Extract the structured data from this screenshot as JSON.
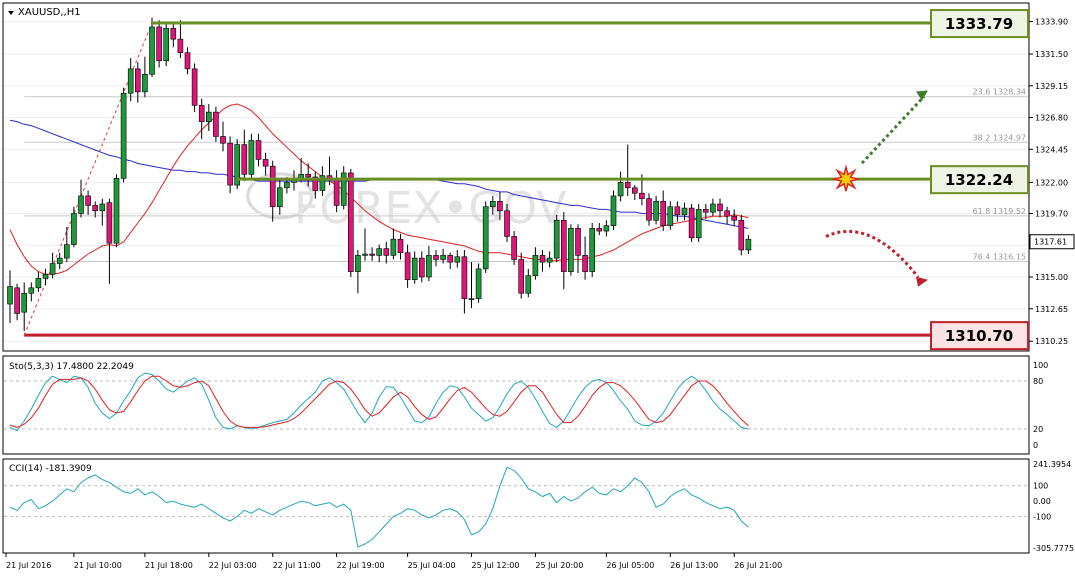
{
  "chart_data": {
    "type": "candlestick",
    "title": "XAUUSD,,H1",
    "price_axis": {
      "range": [
        1309.6,
        1335.2
      ],
      "ticks": [
        "1333.90",
        "1331.50",
        "1329.15",
        "1326.80",
        "1324.45",
        "1322.00",
        "1319.70",
        "1317.35",
        "1315.00",
        "1312.65",
        "1310.25"
      ],
      "tick_values": [
        1333.9,
        1331.5,
        1329.15,
        1326.8,
        1324.45,
        1322.0,
        1319.7,
        1317.35,
        1315.0,
        1312.65,
        1310.25
      ],
      "current_price": "1317.61",
      "current_value": 1317.61
    },
    "time_labels": [
      "21 Jul 2016",
      "21 Jul 10:00",
      "21 Jul 18:00",
      "22 Jul 03:00",
      "22 Jul 11:00",
      "22 Jul 19:00",
      "25 Jul 04:00",
      "25 Jul 12:00",
      "25 Jul 20:00",
      "26 Jul 05:00",
      "26 Jul 13:00",
      "26 Jul 21:00"
    ],
    "candles": [
      [
        1313.0,
        1314.3,
        1311.6,
        1315.5
      ],
      [
        1314.2,
        1312.3,
        1311.8,
        1314.5
      ],
      [
        1312.4,
        1313.8,
        1311.0,
        1314.6
      ],
      [
        1313.8,
        1314.2,
        1313.2,
        1314.6
      ],
      [
        1314.2,
        1314.9,
        1313.9,
        1315.4
      ],
      [
        1314.9,
        1315.2,
        1314.4,
        1315.6
      ],
      [
        1315.2,
        1316.0,
        1314.9,
        1316.8
      ],
      [
        1316.0,
        1316.4,
        1315.6,
        1316.8
      ],
      [
        1316.4,
        1317.4,
        1316.1,
        1318.7
      ],
      [
        1317.4,
        1319.7,
        1317.2,
        1320.2
      ],
      [
        1319.7,
        1321.0,
        1319.4,
        1322.2
      ],
      [
        1321.0,
        1320.3,
        1319.6,
        1321.4
      ],
      [
        1320.3,
        1319.9,
        1319.4,
        1320.6
      ],
      [
        1319.9,
        1320.4,
        1318.8,
        1320.8
      ],
      [
        1320.5,
        1317.5,
        1314.5,
        1320.8
      ],
      [
        1317.5,
        1322.3,
        1317.2,
        1322.6
      ],
      [
        1322.3,
        1328.6,
        1322.0,
        1329.0
      ],
      [
        1328.6,
        1330.4,
        1328.0,
        1331.2
      ],
      [
        1330.4,
        1328.7,
        1327.9,
        1330.9
      ],
      [
        1328.7,
        1330.0,
        1328.3,
        1331.3
      ],
      [
        1330.0,
        1333.5,
        1329.8,
        1334.2
      ],
      [
        1333.5,
        1331.0,
        1330.5,
        1334.0
      ],
      [
        1331.0,
        1333.4,
        1330.6,
        1333.9
      ],
      [
        1333.4,
        1332.6,
        1332.0,
        1333.9
      ],
      [
        1332.6,
        1331.6,
        1331.2,
        1334.0
      ],
      [
        1331.6,
        1330.4,
        1330.0,
        1332.0
      ],
      [
        1330.4,
        1327.7,
        1327.2,
        1330.8
      ],
      [
        1327.7,
        1326.5,
        1325.2,
        1328.2
      ],
      [
        1326.5,
        1327.2,
        1325.8,
        1327.8
      ],
      [
        1327.2,
        1325.4,
        1325.0,
        1327.6
      ],
      [
        1325.4,
        1324.9,
        1324.3,
        1326.5
      ],
      [
        1324.9,
        1321.8,
        1321.2,
        1325.4
      ],
      [
        1321.8,
        1324.8,
        1321.5,
        1325.2
      ],
      [
        1324.8,
        1322.6,
        1322.1,
        1325.9
      ],
      [
        1322.6,
        1325.1,
        1322.3,
        1325.6
      ],
      [
        1325.1,
        1323.7,
        1323.2,
        1325.6
      ],
      [
        1323.7,
        1323.2,
        1322.5,
        1324.2
      ],
      [
        1323.2,
        1320.2,
        1319.1,
        1323.6
      ],
      [
        1320.2,
        1321.6,
        1319.6,
        1322.3
      ],
      [
        1321.6,
        1322.0,
        1321.2,
        1322.4
      ],
      [
        1322.0,
        1322.3,
        1321.4,
        1322.9
      ],
      [
        1322.3,
        1322.6,
        1322.0,
        1323.8
      ],
      [
        1322.6,
        1322.4,
        1321.7,
        1323.4
      ],
      [
        1322.4,
        1321.4,
        1320.8,
        1322.8
      ],
      [
        1321.4,
        1322.5,
        1321.0,
        1323.2
      ],
      [
        1322.5,
        1322.3,
        1321.8,
        1323.9
      ],
      [
        1322.3,
        1320.3,
        1319.8,
        1322.9
      ],
      [
        1320.3,
        1322.7,
        1320.0,
        1323.2
      ],
      [
        1322.7,
        1315.4,
        1315.0,
        1323.0
      ],
      [
        1315.4,
        1316.6,
        1313.8,
        1317.0
      ],
      [
        1316.6,
        1316.7,
        1316.2,
        1318.6
      ],
      [
        1316.7,
        1316.6,
        1316.2,
        1317.2
      ],
      [
        1316.6,
        1317.1,
        1316.1,
        1317.4
      ],
      [
        1317.1,
        1316.6,
        1316.0,
        1317.6
      ],
      [
        1316.6,
        1317.8,
        1316.3,
        1318.6
      ],
      [
        1317.8,
        1316.8,
        1316.3,
        1318.2
      ],
      [
        1316.8,
        1314.8,
        1314.2,
        1317.4
      ],
      [
        1314.8,
        1316.4,
        1314.5,
        1316.9
      ],
      [
        1316.4,
        1315.0,
        1314.6,
        1316.9
      ],
      [
        1315.0,
        1316.6,
        1314.7,
        1317.3
      ],
      [
        1316.6,
        1316.3,
        1315.8,
        1317.0
      ],
      [
        1316.3,
        1316.6,
        1316.0,
        1317.1
      ],
      [
        1316.6,
        1316.1,
        1315.6,
        1316.8
      ],
      [
        1316.1,
        1316.5,
        1315.7,
        1317.0
      ],
      [
        1316.5,
        1313.4,
        1312.3,
        1317.0
      ],
      [
        1313.4,
        1313.4,
        1312.7,
        1316.1
      ],
      [
        1313.4,
        1315.6,
        1313.1,
        1316.0
      ],
      [
        1315.6,
        1320.2,
        1315.3,
        1320.6
      ],
      [
        1320.2,
        1320.6,
        1319.6,
        1321.0
      ],
      [
        1320.6,
        1319.9,
        1319.2,
        1321.3
      ],
      [
        1319.9,
        1318.0,
        1317.6,
        1320.4
      ],
      [
        1318.0,
        1316.3,
        1315.9,
        1318.4
      ],
      [
        1316.3,
        1313.8,
        1313.4,
        1316.8
      ],
      [
        1313.8,
        1315.1,
        1313.5,
        1315.6
      ],
      [
        1315.1,
        1316.6,
        1314.8,
        1317.2
      ],
      [
        1316.6,
        1316.1,
        1315.4,
        1317.0
      ],
      [
        1316.1,
        1316.4,
        1315.7,
        1316.9
      ],
      [
        1316.4,
        1319.2,
        1316.1,
        1319.6
      ],
      [
        1319.2,
        1315.4,
        1314.1,
        1319.8
      ],
      [
        1315.4,
        1318.6,
        1315.1,
        1318.9
      ],
      [
        1318.6,
        1316.6,
        1315.3,
        1318.9
      ],
      [
        1316.6,
        1315.4,
        1314.8,
        1318.0
      ],
      [
        1315.4,
        1318.6,
        1315.0,
        1319.0
      ],
      [
        1318.6,
        1318.4,
        1318.1,
        1319.0
      ],
      [
        1318.4,
        1318.8,
        1318.0,
        1319.2
      ],
      [
        1318.8,
        1321.0,
        1318.5,
        1321.4
      ],
      [
        1321.0,
        1322.0,
        1320.6,
        1322.8
      ],
      [
        1322.0,
        1321.6,
        1321.0,
        1324.8
      ],
      [
        1321.6,
        1321.2,
        1320.7,
        1321.8
      ],
      [
        1321.2,
        1320.8,
        1320.3,
        1322.6
      ],
      [
        1320.8,
        1319.2,
        1318.8,
        1321.2
      ],
      [
        1319.2,
        1320.6,
        1318.9,
        1321.0
      ],
      [
        1320.6,
        1318.8,
        1318.4,
        1321.4
      ],
      [
        1318.8,
        1320.2,
        1318.5,
        1320.6
      ],
      [
        1320.2,
        1319.6,
        1319.1,
        1320.6
      ],
      [
        1319.6,
        1320.1,
        1319.2,
        1320.5
      ],
      [
        1320.1,
        1317.9,
        1317.6,
        1320.4
      ],
      [
        1317.9,
        1320.0,
        1317.6,
        1320.4
      ],
      [
        1320.0,
        1319.8,
        1319.3,
        1320.4
      ],
      [
        1319.8,
        1320.4,
        1319.5,
        1320.8
      ],
      [
        1320.4,
        1319.9,
        1319.4,
        1320.8
      ],
      [
        1319.9,
        1319.5,
        1318.9,
        1320.2
      ],
      [
        1319.5,
        1319.2,
        1318.8,
        1320.0
      ],
      [
        1319.2,
        1317.0,
        1316.6,
        1319.6
      ],
      [
        1317.0,
        1317.8,
        1316.7,
        1318.1
      ]
    ],
    "ma_fast_values": [
      1318.5,
      1317.4,
      1316.5,
      1315.8,
      1315.4,
      1315.2,
      1315.2,
      1315.3,
      1315.5,
      1315.9,
      1316.3,
      1316.7,
      1317.0,
      1317.3,
      1317.4,
      1317.3,
      1317.6,
      1318.3,
      1319.0,
      1319.7,
      1320.5,
      1321.4,
      1322.3,
      1323.2,
      1324.0,
      1324.7,
      1325.3,
      1325.9,
      1326.4,
      1326.9,
      1327.4,
      1327.7,
      1327.8,
      1327.6,
      1327.3,
      1326.8,
      1326.2,
      1325.6,
      1325.1,
      1324.6,
      1324.1,
      1323.6,
      1323.2,
      1322.8,
      1322.4,
      1322.1,
      1321.8,
      1321.4,
      1320.9,
      1320.4,
      1319.9,
      1319.5,
      1319.1,
      1318.8,
      1318.5,
      1318.3,
      1318.1,
      1318.0,
      1317.9,
      1317.8,
      1317.7,
      1317.6,
      1317.5,
      1317.4,
      1317.3,
      1317.1,
      1316.9,
      1316.8,
      1316.8,
      1316.8,
      1316.7,
      1316.6,
      1316.5,
      1316.4,
      1316.3,
      1316.3,
      1316.2,
      1316.2,
      1316.3,
      1316.3,
      1316.3,
      1316.3,
      1316.5,
      1316.6,
      1316.8,
      1317.0,
      1317.3,
      1317.6,
      1317.9,
      1318.2,
      1318.4,
      1318.6,
      1318.8,
      1318.9,
      1319.0,
      1319.1,
      1319.2,
      1319.3,
      1319.4,
      1319.5,
      1319.5,
      1319.5,
      1319.6,
      1319.5,
      1319.4
    ],
    "ma_slow_values": [
      1326.6,
      1326.5,
      1326.3,
      1326.2,
      1326.0,
      1325.8,
      1325.6,
      1325.4,
      1325.2,
      1325.0,
      1324.8,
      1324.6,
      1324.4,
      1324.2,
      1324.0,
      1323.9,
      1323.7,
      1323.6,
      1323.4,
      1323.3,
      1323.2,
      1323.1,
      1323.0,
      1322.9,
      1322.9,
      1322.8,
      1322.8,
      1322.7,
      1322.7,
      1322.6,
      1322.6,
      1322.5,
      1322.4,
      1322.3,
      1322.2,
      1322.1,
      1322.1,
      1322.1,
      1322.1,
      1322.1,
      1322.1,
      1322.1,
      1322.1,
      1322.1,
      1322.1,
      1322.1,
      1322.1,
      1322.1,
      1322.1,
      1322.1,
      1322.1,
      1322.2,
      1322.3,
      1322.3,
      1322.3,
      1322.3,
      1322.3,
      1322.3,
      1322.2,
      1322.2,
      1322.2,
      1322.1,
      1322.0,
      1321.9,
      1321.9,
      1321.8,
      1321.7,
      1321.5,
      1321.4,
      1321.3,
      1321.3,
      1321.1,
      1321.0,
      1320.9,
      1320.8,
      1320.7,
      1320.6,
      1320.5,
      1320.4,
      1320.3,
      1320.3,
      1320.2,
      1320.1,
      1320.0,
      1320.0,
      1319.9,
      1319.8,
      1319.8,
      1319.8,
      1319.7,
      1319.7,
      1319.7,
      1319.7,
      1319.6,
      1319.5,
      1319.5,
      1319.4,
      1319.3,
      1319.2,
      1319.1,
      1319.0,
      1318.9,
      1318.8,
      1318.7,
      1318.6
    ],
    "levels": {
      "resistance": {
        "value": "1333.79",
        "price": 1333.79,
        "start_index": 20
      },
      "pivot": {
        "value": "1322.24",
        "price": 1322.24,
        "start_index": 32
      },
      "support": {
        "value": "1310.70",
        "price": 1310.7,
        "start_index": 2
      }
    },
    "fibonacci": [
      {
        "label": "23.6 1328.34",
        "price": 1328.34
      },
      {
        "label": "38.2 1324.97",
        "price": 1324.97
      },
      {
        "label": "61.8 1319.52",
        "price": 1319.52
      },
      {
        "label": "76.4 1316.15",
        "price": 1316.15
      }
    ],
    "fib_trend_from": {
      "index": 2,
      "price": 1310.7
    },
    "fib_trend_to": {
      "index": 20,
      "price": 1333.79
    },
    "stochastic": {
      "label": "Sto(5,3,3) 17.4800 22.2049",
      "ticks": [
        "100",
        "80",
        "20",
        "0"
      ],
      "tick_values": [
        100,
        80,
        20,
        0
      ],
      "k_values": [
        22,
        18,
        30,
        45,
        62,
        78,
        86,
        82,
        78,
        86,
        84,
        72,
        52,
        40,
        33,
        40,
        55,
        68,
        84,
        90,
        88,
        80,
        70,
        66,
        73,
        80,
        84,
        76,
        56,
        34,
        22,
        20,
        24,
        22,
        20,
        22,
        25,
        28,
        30,
        32,
        40,
        50,
        58,
        66,
        80,
        84,
        78,
        70,
        55,
        40,
        28,
        40,
        60,
        73,
        72,
        60,
        45,
        30,
        28,
        35,
        52,
        66,
        74,
        72,
        60,
        46,
        38,
        30,
        34,
        48,
        64,
        76,
        80,
        72,
        58,
        42,
        27,
        22,
        30,
        45,
        60,
        72,
        80,
        82,
        78,
        68,
        55,
        45,
        30,
        25,
        24,
        30,
        40,
        55,
        70,
        80,
        86,
        80,
        68,
        55,
        45,
        38,
        30,
        22,
        20
      ],
      "d_values": [
        25,
        22,
        26,
        34,
        46,
        62,
        76,
        82,
        82,
        82,
        84,
        80,
        70,
        56,
        44,
        40,
        42,
        54,
        68,
        80,
        86,
        86,
        80,
        74,
        72,
        74,
        78,
        80,
        74,
        58,
        42,
        30,
        24,
        22,
        22,
        22,
        23,
        25,
        27,
        29,
        33,
        40,
        49,
        58,
        67,
        76,
        80,
        78,
        70,
        58,
        44,
        36,
        40,
        50,
        60,
        66,
        60,
        48,
        38,
        32,
        35,
        46,
        58,
        68,
        72,
        66,
        56,
        46,
        38,
        36,
        42,
        54,
        66,
        74,
        74,
        66,
        52,
        38,
        28,
        28,
        36,
        48,
        62,
        72,
        78,
        78,
        74,
        66,
        56,
        44,
        32,
        28,
        30,
        38,
        50,
        62,
        74,
        80,
        80,
        74,
        64,
        52,
        42,
        32,
        24
      ]
    },
    "cci": {
      "label": "CCI(14) -181.3909",
      "ticks": [
        "241.3954",
        "100",
        "0.00",
        "-100",
        "-305.7775"
      ],
      "tick_values": [
        241.3954,
        100,
        0,
        -100,
        -305.7775
      ],
      "values": [
        -40,
        -60,
        -10,
        10,
        -50,
        -30,
        0,
        40,
        80,
        60,
        120,
        150,
        170,
        140,
        120,
        90,
        60,
        50,
        80,
        40,
        60,
        30,
        -10,
        0,
        -20,
        -30,
        -40,
        -20,
        -50,
        -80,
        -110,
        -130,
        -100,
        -60,
        -80,
        -50,
        -70,
        -90,
        -60,
        -40,
        -20,
        0,
        -10,
        -30,
        -20,
        -10,
        -40,
        -20,
        -60,
        -300,
        -280,
        -250,
        -200,
        -150,
        -100,
        -80,
        -50,
        -60,
        -90,
        -110,
        -90,
        -60,
        -50,
        -70,
        -120,
        -220,
        -200,
        -150,
        -50,
        100,
        220,
        200,
        150,
        80,
        60,
        30,
        50,
        -10,
        30,
        0,
        20,
        60,
        90,
        50,
        40,
        80,
        60,
        100,
        150,
        120,
        60,
        -40,
        -20,
        30,
        60,
        80,
        40,
        20,
        -10,
        -30,
        -50,
        -40,
        -60,
        -130,
        -170
      ]
    },
    "annotations": {
      "watermark": "FOREX•GOV"
    }
  }
}
